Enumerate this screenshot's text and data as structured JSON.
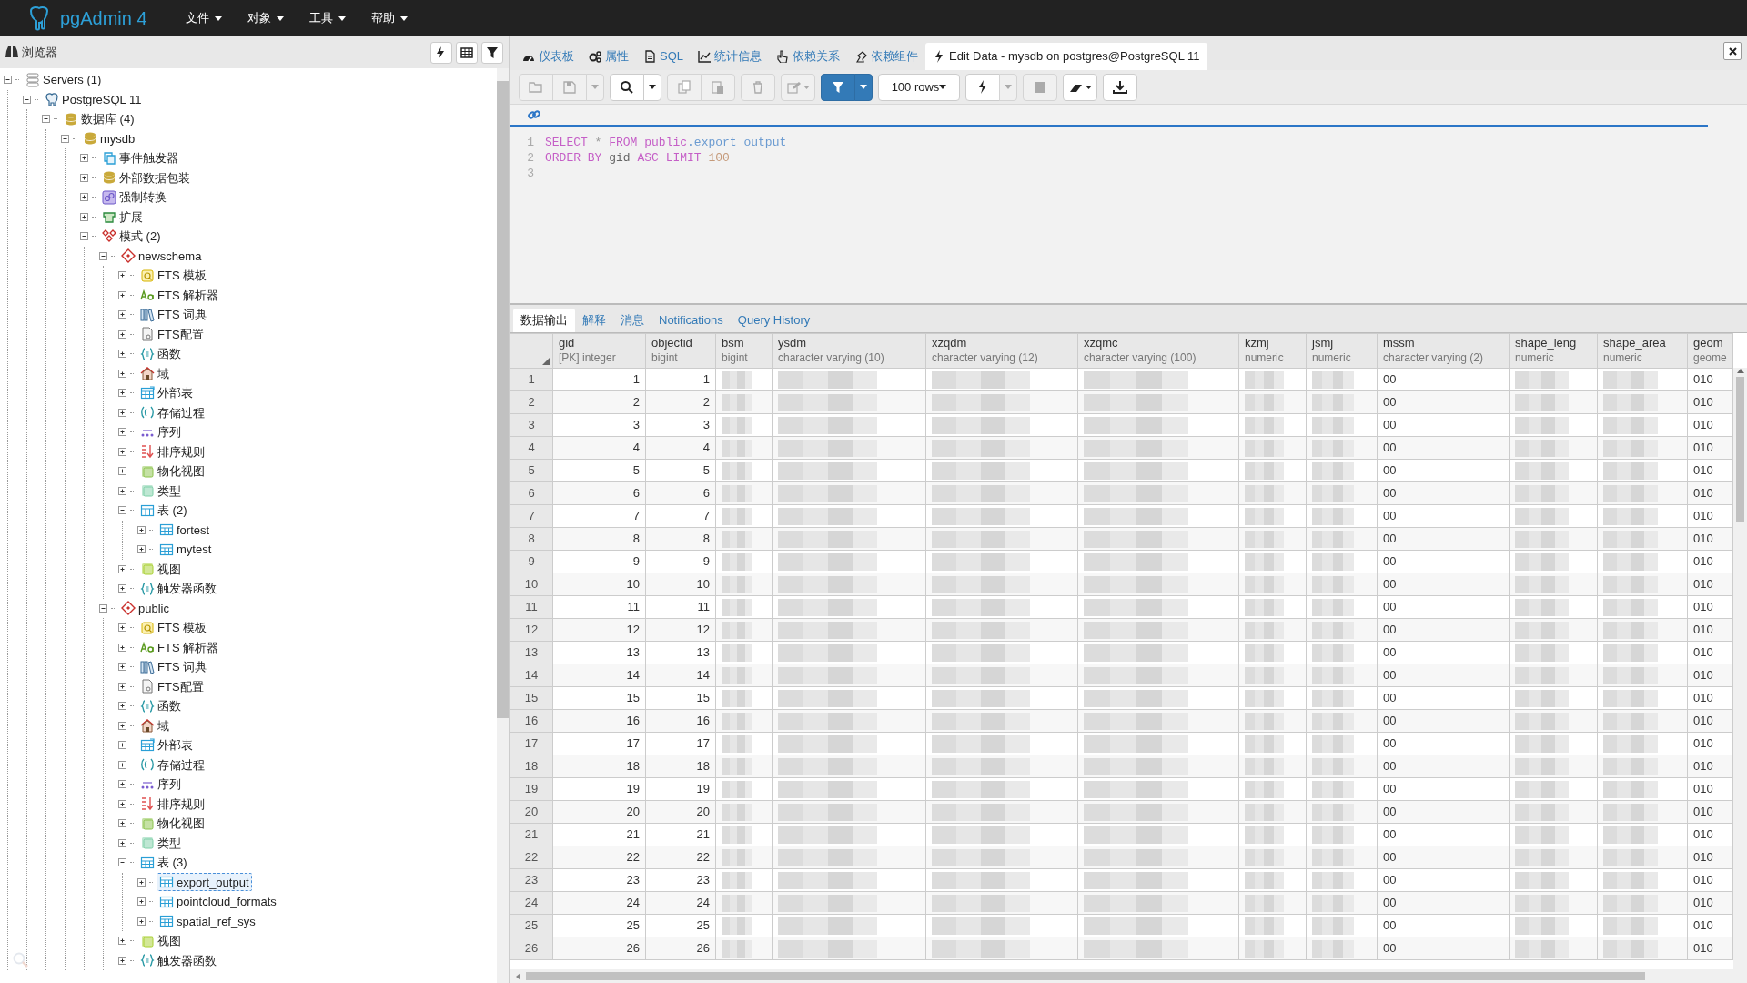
{
  "app": {
    "title": "pgAdmin 4",
    "menus": [
      {
        "label": "文件"
      },
      {
        "label": "对象"
      },
      {
        "label": "工具"
      },
      {
        "label": "帮助"
      }
    ]
  },
  "browser": {
    "title": "浏览器",
    "tools": [
      {
        "kind": "bolt"
      },
      {
        "kind": "grid"
      },
      {
        "kind": "filter"
      }
    ],
    "tree": [
      {
        "label": "Servers (1)",
        "kind": "servers",
        "expanded": true,
        "selected": false,
        "children": [
          {
            "label": "PostgreSQL 11",
            "kind": "server",
            "expanded": true,
            "selected": false,
            "children": [
              {
                "label": "数据库 (4)",
                "kind": "databases",
                "expanded": true,
                "selected": false,
                "children": [
                  {
                    "label": "mysdb",
                    "kind": "database",
                    "expanded": true,
                    "selected": false,
                    "children": [
                      {
                        "label": "事件触发器",
                        "kind": "event-trigger",
                        "expanded": false,
                        "selected": false
                      },
                      {
                        "label": "外部数据包装",
                        "kind": "fdw",
                        "expanded": false,
                        "selected": false
                      },
                      {
                        "label": "强制转换",
                        "kind": "cast",
                        "expanded": false,
                        "selected": false
                      },
                      {
                        "label": "扩展",
                        "kind": "extension",
                        "expanded": false,
                        "selected": false
                      },
                      {
                        "label": "模式 (2)",
                        "kind": "schemas",
                        "expanded": true,
                        "selected": false,
                        "children": [
                          {
                            "label": "newschema",
                            "kind": "schema",
                            "expanded": true,
                            "selected": false,
                            "children": [
                              {
                                "label": "FTS 模板",
                                "kind": "fts-template",
                                "expanded": false,
                                "selected": false
                              },
                              {
                                "label": "FTS 解析器",
                                "kind": "fts-parser",
                                "expanded": false,
                                "selected": false
                              },
                              {
                                "label": "FTS 词典",
                                "kind": "fts-dict",
                                "expanded": false,
                                "selected": false
                              },
                              {
                                "label": "FTS配置",
                                "kind": "fts-config",
                                "expanded": false,
                                "selected": false
                              },
                              {
                                "label": "函数",
                                "kind": "function",
                                "expanded": false,
                                "selected": false
                              },
                              {
                                "label": "域",
                                "kind": "domain",
                                "expanded": false,
                                "selected": false
                              },
                              {
                                "label": "外部表",
                                "kind": "foreign-table",
                                "expanded": false,
                                "selected": false
                              },
                              {
                                "label": "存储过程",
                                "kind": "procedure",
                                "expanded": false,
                                "selected": false
                              },
                              {
                                "label": "序列",
                                "kind": "sequence",
                                "expanded": false,
                                "selected": false
                              },
                              {
                                "label": "排序规则",
                                "kind": "collation",
                                "expanded": false,
                                "selected": false
                              },
                              {
                                "label": "物化视图",
                                "kind": "mview",
                                "expanded": false,
                                "selected": false
                              },
                              {
                                "label": "类型",
                                "kind": "type",
                                "expanded": false,
                                "selected": false
                              },
                              {
                                "label": "表 (2)",
                                "kind": "tables",
                                "expanded": true,
                                "selected": false,
                                "children": [
                                  {
                                    "label": "fortest",
                                    "kind": "table",
                                    "expanded": false,
                                    "selected": false
                                  },
                                  {
                                    "label": "mytest",
                                    "kind": "table",
                                    "expanded": false,
                                    "selected": false
                                  }
                                ]
                              },
                              {
                                "label": "视图",
                                "kind": "view",
                                "expanded": false,
                                "selected": false
                              },
                              {
                                "label": "触发器函数",
                                "kind": "trigger-function",
                                "expanded": false,
                                "selected": false
                              }
                            ]
                          },
                          {
                            "label": "public",
                            "kind": "schema",
                            "expanded": true,
                            "selected": false,
                            "children": [
                              {
                                "label": "FTS 模板",
                                "kind": "fts-template",
                                "expanded": false,
                                "selected": false
                              },
                              {
                                "label": "FTS 解析器",
                                "kind": "fts-parser",
                                "expanded": false,
                                "selected": false
                              },
                              {
                                "label": "FTS 词典",
                                "kind": "fts-dict",
                                "expanded": false,
                                "selected": false
                              },
                              {
                                "label": "FTS配置",
                                "kind": "fts-config",
                                "expanded": false,
                                "selected": false
                              },
                              {
                                "label": "函数",
                                "kind": "function",
                                "expanded": false,
                                "selected": false
                              },
                              {
                                "label": "域",
                                "kind": "domain",
                                "expanded": false,
                                "selected": false
                              },
                              {
                                "label": "外部表",
                                "kind": "foreign-table",
                                "expanded": false,
                                "selected": false
                              },
                              {
                                "label": "存储过程",
                                "kind": "procedure",
                                "expanded": false,
                                "selected": false
                              },
                              {
                                "label": "序列",
                                "kind": "sequence",
                                "expanded": false,
                                "selected": false
                              },
                              {
                                "label": "排序规则",
                                "kind": "collation",
                                "expanded": false,
                                "selected": false
                              },
                              {
                                "label": "物化视图",
                                "kind": "mview",
                                "expanded": false,
                                "selected": false
                              },
                              {
                                "label": "类型",
                                "kind": "type",
                                "expanded": false,
                                "selected": false
                              },
                              {
                                "label": "表 (3)",
                                "kind": "tables",
                                "expanded": true,
                                "selected": false,
                                "children": [
                                  {
                                    "label": "export_output",
                                    "kind": "table",
                                    "expanded": false,
                                    "selected": true
                                  },
                                  {
                                    "label": "pointcloud_formats",
                                    "kind": "table",
                                    "expanded": false,
                                    "selected": false
                                  },
                                  {
                                    "label": "spatial_ref_sys",
                                    "kind": "table",
                                    "expanded": false,
                                    "selected": false
                                  }
                                ]
                              },
                              {
                                "label": "视图",
                                "kind": "view",
                                "expanded": false,
                                "selected": false
                              },
                              {
                                "label": "触发器函数",
                                "kind": "trigger-function",
                                "expanded": false,
                                "selected": false
                              }
                            ]
                          }
                        ]
                      }
                    ]
                  }
                ]
              }
            ]
          }
        ]
      }
    ]
  },
  "tabs": [
    {
      "label": "仪表板",
      "kind": "dashboard",
      "selected": false
    },
    {
      "label": "属性",
      "kind": "properties",
      "selected": false
    },
    {
      "label": "SQL",
      "kind": "sql",
      "selected": false
    },
    {
      "label": "统计信息",
      "kind": "statistics",
      "selected": false
    },
    {
      "label": "依赖关系",
      "kind": "dependencies",
      "selected": false
    },
    {
      "label": "依赖组件",
      "kind": "dependents",
      "selected": false
    },
    {
      "label": "Edit Data - mysdb on postgres@PostgreSQL 11",
      "kind": "edit-data",
      "selected": true
    }
  ],
  "toolbar": [
    {
      "buttons": [
        {
          "kind": "open",
          "disabled": true
        },
        {
          "kind": "save",
          "disabled": true
        },
        {
          "kind": "caret",
          "disabled": true
        }
      ]
    },
    {
      "buttons": [
        {
          "kind": "search",
          "disabled": false
        },
        {
          "kind": "caret",
          "disabled": false
        }
      ]
    },
    {
      "buttons": [
        {
          "kind": "copy",
          "disabled": true
        },
        {
          "kind": "paste",
          "disabled": true
        }
      ]
    },
    {
      "buttons": [
        {
          "kind": "delete",
          "disabled": true
        }
      ]
    },
    {
      "buttons": [
        {
          "kind": "edit-menu",
          "disabled": true
        }
      ]
    },
    {
      "buttons": [
        {
          "kind": "filter",
          "disabled": false
        },
        {
          "kind": "caret-primary",
          "disabled": false
        }
      ]
    },
    {
      "buttons": [
        {
          "kind": "select",
          "value": "100 rows",
          "disabled": false
        }
      ]
    },
    {
      "buttons": [
        {
          "kind": "execute",
          "disabled": false
        },
        {
          "kind": "caret",
          "disabled": true
        }
      ]
    },
    {
      "buttons": [
        {
          "kind": "stop",
          "disabled": true
        }
      ]
    },
    {
      "buttons": [
        {
          "kind": "eraser-menu",
          "disabled": false
        }
      ]
    },
    {
      "buttons": [
        {
          "kind": "download",
          "disabled": false
        }
      ]
    }
  ],
  "editor": {
    "lines": [
      {
        "number": "1",
        "tokens": [
          {
            "text": "SELECT",
            "kind": "keyword"
          },
          {
            "text": " * ",
            "kind": "operator"
          },
          {
            "text": "FROM",
            "kind": "keyword"
          },
          {
            "text": " public",
            "kind": "keyword"
          },
          {
            "text": ".export_output",
            "kind": "identifier"
          }
        ]
      },
      {
        "number": "2",
        "tokens": [
          {
            "text": "ORDER BY",
            "kind": "keyword"
          },
          {
            "text": " gid ",
            "kind": "plain"
          },
          {
            "text": "ASC LIMIT",
            "kind": "keyword"
          },
          {
            "text": " 100",
            "kind": "number"
          }
        ]
      },
      {
        "number": "3"
      }
    ]
  },
  "result_tabs": [
    {
      "label": "数据输出",
      "selected": true
    },
    {
      "label": "解释",
      "selected": false
    },
    {
      "label": "消息",
      "selected": false
    },
    {
      "label": "Notifications",
      "selected": false
    },
    {
      "label": "Query History",
      "selected": false
    }
  ],
  "grid": {
    "columns": [
      {
        "name": "gid",
        "type": "[PK] integer",
        "masked": false
      },
      {
        "name": "objectid",
        "type": "bigint",
        "masked": false
      },
      {
        "name": "bsm",
        "type": "bigint",
        "masked": true
      },
      {
        "name": "ysdm",
        "type": "character varying (10)",
        "masked": true
      },
      {
        "name": "xzqdm",
        "type": "character varying (12)",
        "masked": true
      },
      {
        "name": "xzqmc",
        "type": "character varying (100)",
        "masked": true
      },
      {
        "name": "kzmj",
        "type": "numeric",
        "masked": true
      },
      {
        "name": "jsmj",
        "type": "numeric",
        "masked": true
      },
      {
        "name": "mssm",
        "type": "character varying (2)",
        "masked": false
      },
      {
        "name": "shape_leng",
        "type": "numeric",
        "masked": true
      },
      {
        "name": "shape_area",
        "type": "numeric",
        "masked": true
      },
      {
        "name": "geom",
        "type": "geome",
        "masked": false
      }
    ],
    "rows": [
      {
        "number": "1",
        "cells": [
          "1",
          "1",
          "00",
          "010"
        ]
      },
      {
        "number": "2",
        "cells": [
          "2",
          "2",
          "00",
          "010"
        ]
      },
      {
        "number": "3",
        "cells": [
          "3",
          "3",
          "00",
          "010"
        ]
      },
      {
        "number": "4",
        "cells": [
          "4",
          "4",
          "00",
          "010"
        ]
      },
      {
        "number": "5",
        "cells": [
          "5",
          "5",
          "00",
          "010"
        ]
      },
      {
        "number": "6",
        "cells": [
          "6",
          "6",
          "00",
          "010"
        ]
      },
      {
        "number": "7",
        "cells": [
          "7",
          "7",
          "00",
          "010"
        ]
      },
      {
        "number": "8",
        "cells": [
          "8",
          "8",
          "00",
          "010"
        ]
      },
      {
        "number": "9",
        "cells": [
          "9",
          "9",
          "00",
          "010"
        ]
      },
      {
        "number": "10",
        "cells": [
          "10",
          "10",
          "00",
          "010"
        ]
      },
      {
        "number": "11",
        "cells": [
          "11",
          "11",
          "00",
          "010"
        ]
      },
      {
        "number": "12",
        "cells": [
          "12",
          "12",
          "00",
          "010"
        ]
      },
      {
        "number": "13",
        "cells": [
          "13",
          "13",
          "00",
          "010"
        ]
      },
      {
        "number": "14",
        "cells": [
          "14",
          "14",
          "00",
          "010"
        ]
      },
      {
        "number": "15",
        "cells": [
          "15",
          "15",
          "00",
          "010"
        ]
      },
      {
        "number": "16",
        "cells": [
          "16",
          "16",
          "00",
          "010"
        ]
      },
      {
        "number": "17",
        "cells": [
          "17",
          "17",
          "00",
          "010"
        ]
      },
      {
        "number": "18",
        "cells": [
          "18",
          "18",
          "00",
          "010"
        ]
      },
      {
        "number": "19",
        "cells": [
          "19",
          "19",
          "00",
          "010"
        ]
      },
      {
        "number": "20",
        "cells": [
          "20",
          "20",
          "00",
          "010"
        ]
      },
      {
        "number": "21",
        "cells": [
          "21",
          "21",
          "00",
          "010"
        ]
      },
      {
        "number": "22",
        "cells": [
          "22",
          "22",
          "00",
          "010"
        ]
      },
      {
        "number": "23",
        "cells": [
          "23",
          "23",
          "00",
          "010"
        ]
      },
      {
        "number": "24",
        "cells": [
          "24",
          "24",
          "00",
          "010"
        ]
      },
      {
        "number": "25",
        "cells": [
          "25",
          "25",
          "00",
          "010"
        ]
      },
      {
        "number": "26",
        "cells": [
          "26",
          "26",
          "00",
          "010"
        ]
      }
    ]
  }
}
